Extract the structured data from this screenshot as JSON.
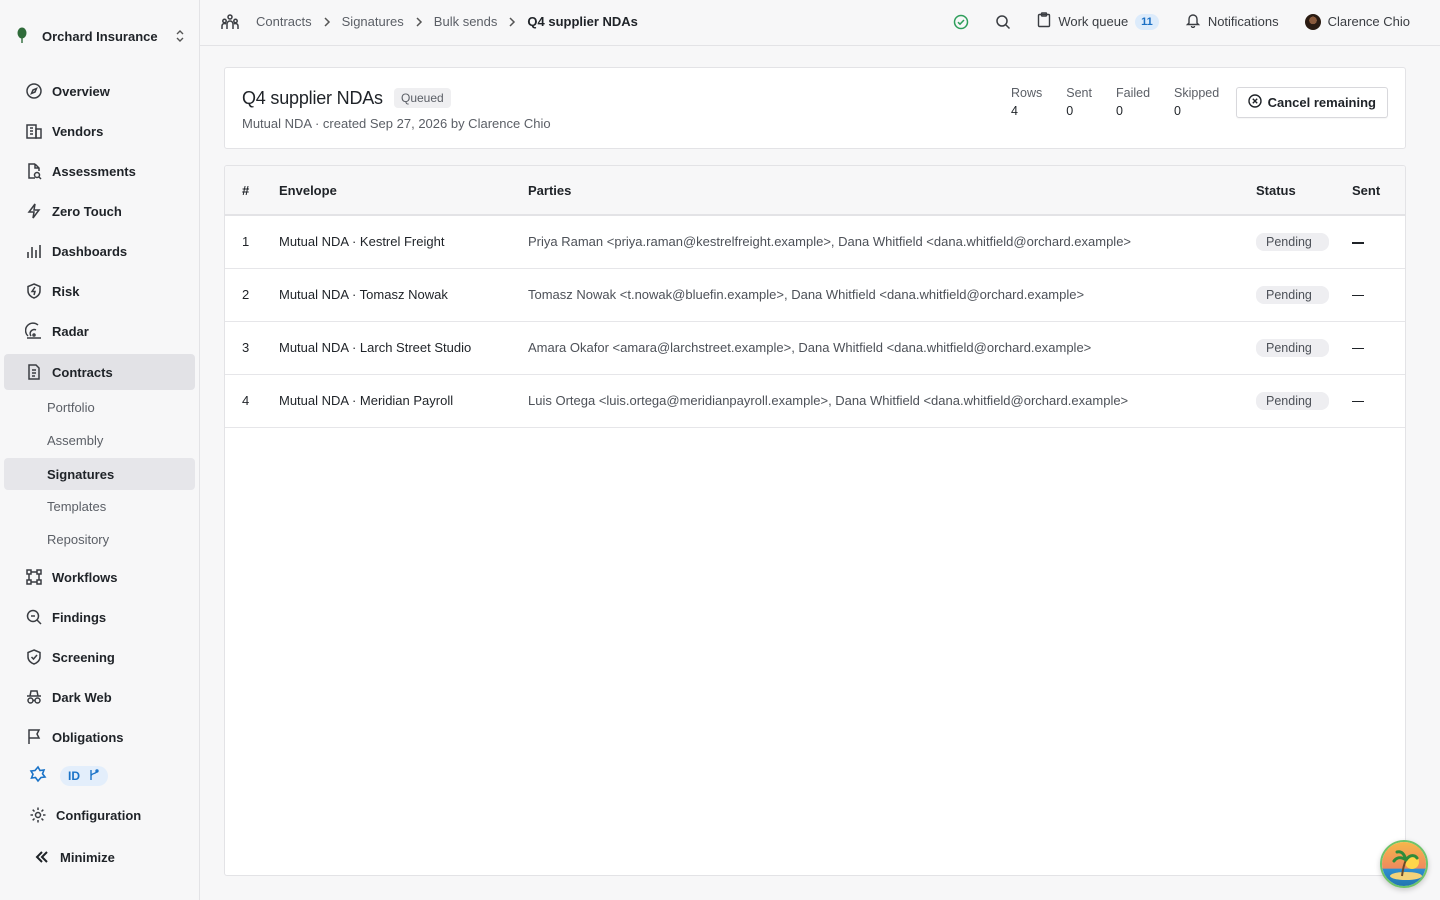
{
  "org": {
    "name": "Orchard Insurance"
  },
  "nav": {
    "overview": "Overview",
    "vendors": "Vendors",
    "assessments": "Assessments",
    "zero_touch": "Zero Touch",
    "dashboards": "Dashboards",
    "risk": "Risk",
    "radar": "Radar",
    "contracts": "Contracts",
    "contracts_sub": [
      "Portfolio",
      "Assembly",
      "Signatures",
      "Templates",
      "Repository"
    ],
    "workflows": "Workflows",
    "findings": "Findings",
    "screening": "Screening",
    "dark_web": "Dark Web",
    "obligations": "Obligations",
    "id_label": "ID",
    "configuration": "Configuration",
    "minimize": "Minimize"
  },
  "breadcrumb": [
    "Contracts",
    "Signatures",
    "Bulk sends",
    "Q4 supplier NDAs"
  ],
  "topbar": {
    "work_queue_label": "Work queue",
    "work_queue_count": "11",
    "notifications_label": "Notifications",
    "user_name": "Clarence Chio"
  },
  "header": {
    "title": "Q4 supplier NDAs",
    "status": "Queued",
    "subtitle": "Mutual NDA · created Sep 27, 2026 by Clarence Chio",
    "stats": [
      {
        "label": "Rows",
        "value": "4"
      },
      {
        "label": "Sent",
        "value": "0"
      },
      {
        "label": "Failed",
        "value": "0"
      },
      {
        "label": "Skipped",
        "value": "0"
      }
    ],
    "cancel_label": "Cancel remaining"
  },
  "table": {
    "columns": [
      "#",
      "Envelope",
      "Parties",
      "Status",
      "Sent"
    ],
    "rows": [
      {
        "num": "1",
        "envelope": "Mutual NDA · Kestrel Freight",
        "parties": "Priya Raman <priya.raman@kestrelfreight.example>, Dana Whitfield <dana.whitfield@orchard.example>",
        "status": "Pending"
      },
      {
        "num": "2",
        "envelope": "Mutual NDA · Tomasz Nowak",
        "parties": "Tomasz Nowak <t.nowak@bluefin.example>, Dana Whitfield <dana.whitfield@orchard.example>",
        "status": "Pending"
      },
      {
        "num": "3",
        "envelope": "Mutual NDA · Larch Street Studio",
        "parties": "Amara Okafor <amara@larchstreet.example>, Dana Whitfield <dana.whitfield@orchard.example>",
        "status": "Pending"
      },
      {
        "num": "4",
        "envelope": "Mutual NDA · Meridian Payroll",
        "parties": "Luis Ortega <luis.ortega@meridianpayroll.example>, Dana Whitfield <dana.whitfield@orchard.example>",
        "status": "Pending"
      }
    ]
  },
  "colors": {
    "accent": "#1a73c8",
    "success": "#2e9e5b",
    "brand_leaf": "#2f6b3a"
  }
}
